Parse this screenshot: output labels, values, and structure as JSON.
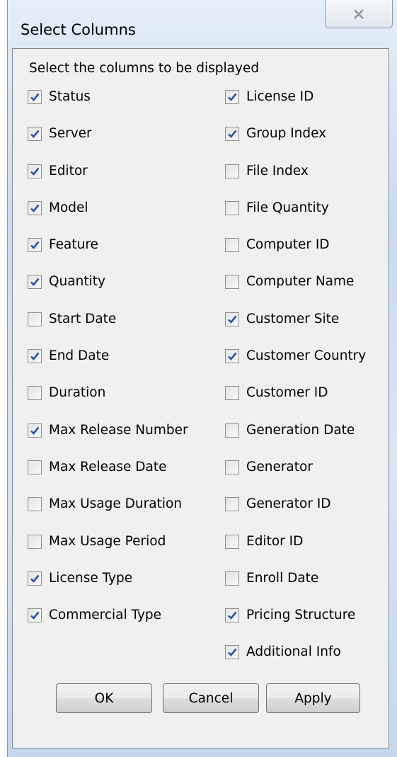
{
  "window": {
    "title": "Select Columns",
    "close_icon": "close-x-icon"
  },
  "instructions": "Select the columns to be displayed",
  "left_columns": [
    {
      "label": "Status",
      "checked": true
    },
    {
      "label": "Server",
      "checked": true
    },
    {
      "label": "Editor",
      "checked": true
    },
    {
      "label": "Model",
      "checked": true
    },
    {
      "label": "Feature",
      "checked": true
    },
    {
      "label": "Quantity",
      "checked": true
    },
    {
      "label": "Start Date",
      "checked": false
    },
    {
      "label": "End Date",
      "checked": true
    },
    {
      "label": "Duration",
      "checked": false
    },
    {
      "label": "Max Release Number",
      "checked": true
    },
    {
      "label": "Max Release Date",
      "checked": false
    },
    {
      "label": "Max Usage Duration",
      "checked": false
    },
    {
      "label": "Max Usage Period",
      "checked": false
    },
    {
      "label": "License Type",
      "checked": true
    },
    {
      "label": "Commercial Type",
      "checked": true
    }
  ],
  "right_columns": [
    {
      "label": "License ID",
      "checked": true
    },
    {
      "label": "Group Index",
      "checked": true
    },
    {
      "label": "File Index",
      "checked": false
    },
    {
      "label": "File Quantity",
      "checked": false
    },
    {
      "label": "Computer ID",
      "checked": false
    },
    {
      "label": "Computer Name",
      "checked": false
    },
    {
      "label": "Customer Site",
      "checked": true
    },
    {
      "label": "Customer Country",
      "checked": true
    },
    {
      "label": "Customer ID",
      "checked": false
    },
    {
      "label": "Generation Date",
      "checked": false
    },
    {
      "label": "Generator",
      "checked": false
    },
    {
      "label": "Generator ID",
      "checked": false
    },
    {
      "label": "Editor ID",
      "checked": false
    },
    {
      "label": "Enroll Date",
      "checked": false
    },
    {
      "label": "Pricing Structure",
      "checked": true
    },
    {
      "label": "Additional Info",
      "checked": true
    }
  ],
  "buttons": {
    "ok": "OK",
    "cancel": "Cancel",
    "apply": "Apply"
  },
  "colors": {
    "check": "#2a52a6",
    "panel": "#f0f0f0"
  }
}
